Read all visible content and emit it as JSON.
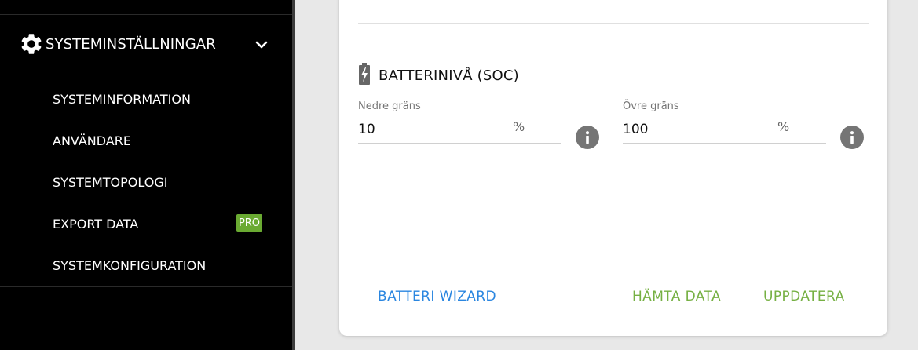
{
  "sidebar": {
    "section_title": "SYSTEMINSTÄLLNINGAR",
    "section_icon": "gear-icon",
    "expand_icon": "chevron-down-icon",
    "items": [
      {
        "label": "SYSTEMINFORMATION"
      },
      {
        "label": "ANVÄNDARE"
      },
      {
        "label": "SYSTEMTOPOLOGI"
      },
      {
        "label": "EXPORT DATA",
        "badge": "PRO"
      },
      {
        "label": "SYSTEMKONFIGURATION"
      }
    ]
  },
  "card": {
    "section": {
      "icon": "battery-charging-icon",
      "title": "BATTERINIVÅ (SOC)"
    },
    "fields": [
      {
        "label": "Nedre gräns",
        "value": "10",
        "unit": "%",
        "info_icon": "info-icon"
      },
      {
        "label": "Övre gräns",
        "value": "100",
        "unit": "%",
        "info_icon": "info-icon"
      }
    ],
    "actions": {
      "wizard": "BATTERI WIZARD",
      "fetch": "HÄMTA DATA",
      "update": "UPPDATERA"
    }
  },
  "colors": {
    "sidebar_bg": "#000000",
    "page_bg": "#e8e8e8",
    "primary_blue": "#2a86e0",
    "action_green": "#76b043",
    "pro_badge": "#6aaa32",
    "info_icon": "#757575"
  }
}
